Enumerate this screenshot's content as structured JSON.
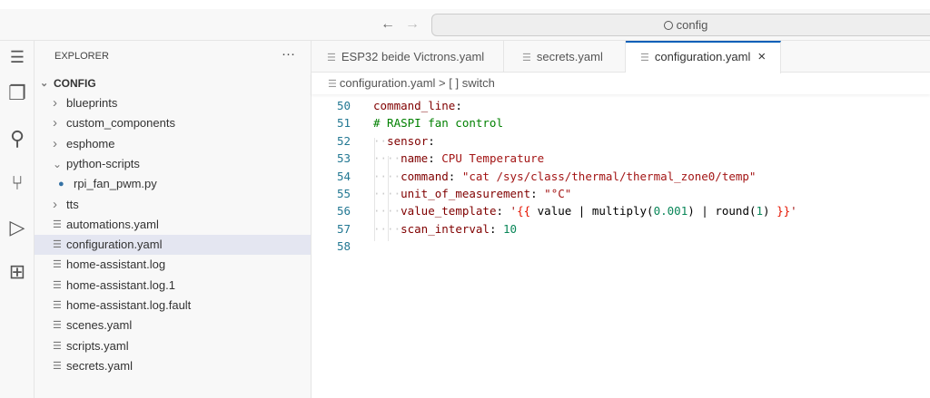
{
  "titlebar": {
    "back": "←",
    "forward": "→",
    "search": "config",
    "search_icon": "search-icon"
  },
  "activity": [
    "menu-icon",
    "explorer-icon",
    "search-icon",
    "source-control-icon",
    "run-debug-icon",
    "extensions-icon"
  ],
  "sidebar": {
    "title": "EXPLORER",
    "more": "···",
    "root": "CONFIG",
    "items": [
      {
        "label": "blueprints",
        "type": "folder",
        "open": false
      },
      {
        "label": "custom_components",
        "type": "folder",
        "open": false
      },
      {
        "label": "esphome",
        "type": "folder",
        "open": false
      },
      {
        "label": "python-scripts",
        "type": "folder",
        "open": true
      },
      {
        "label": "rpi_fan_pwm.py",
        "type": "python"
      },
      {
        "label": "tts",
        "type": "folder",
        "open": false
      },
      {
        "label": "automations.yaml",
        "type": "file"
      },
      {
        "label": "configuration.yaml",
        "type": "file",
        "selected": true
      },
      {
        "label": "home-assistant.log",
        "type": "file"
      },
      {
        "label": "home-assistant.log.1",
        "type": "file"
      },
      {
        "label": "home-assistant.log.fault",
        "type": "file"
      },
      {
        "label": "scenes.yaml",
        "type": "file"
      },
      {
        "label": "scripts.yaml",
        "type": "file"
      },
      {
        "label": "secrets.yaml",
        "type": "file"
      }
    ]
  },
  "tabs": [
    {
      "label": "ESP32 beide Victrons.yaml"
    },
    {
      "label": "secrets.yaml"
    },
    {
      "label": "configuration.yaml",
      "active": true,
      "close": "×"
    }
  ],
  "breadcrumb": {
    "file": "configuration.yaml",
    "sep": ">",
    "symbol": "[ ] switch"
  },
  "code": {
    "line_numbers": [
      "50",
      "51",
      "52",
      "53",
      "54",
      "55",
      "56",
      "57",
      "58"
    ]
  },
  "colors": {
    "accent": "#005fb8",
    "key": "#800000",
    "comment": "#008000",
    "string": "#a31515",
    "number": "#098658"
  }
}
